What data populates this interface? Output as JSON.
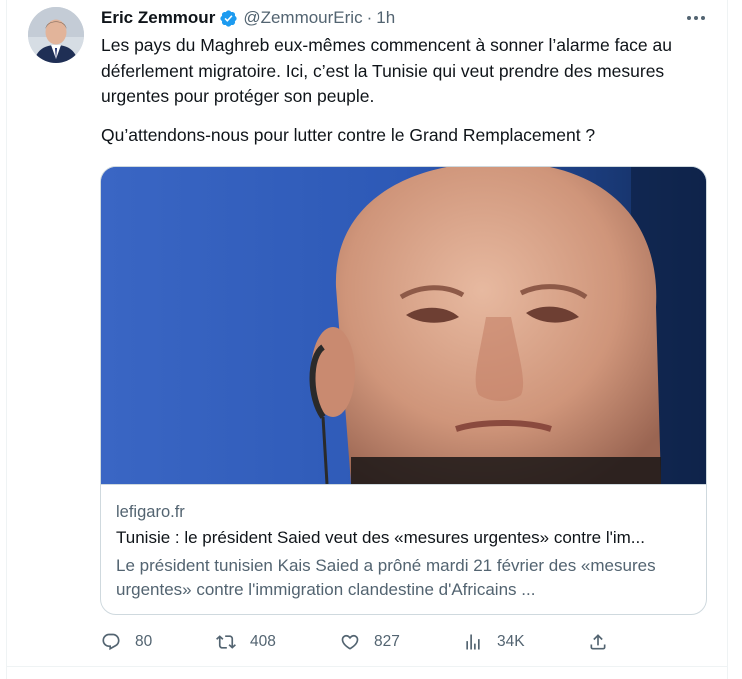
{
  "tweet": {
    "author": {
      "name": "Eric Zemmour",
      "handle": "@ZemmourEric",
      "separator": "·",
      "time": "1h",
      "verified_badge_color": "#1d9bf0"
    },
    "text_paragraphs": [
      "Les pays du Maghreb eux-mêmes commencent à sonner l’alarme face au déferlement migratoire. Ici, c’est la Tunisie qui veut prendre des mesures urgentes pour protéger son peuple.",
      "Qu’attendons-nous pour lutter contre le Grand Remplacement ?"
    ],
    "card": {
      "domain": "lefigaro.fr",
      "title": "Tunisie : le président Saied veut des «mesures urgentes» contre l'im...",
      "description": "Le président tunisien Kais Saied a prôné mardi 21 février des «mesures urgentes» contre l'immigration clandestine d'Africains ..."
    },
    "actions": {
      "reply": {
        "icon": "reply-icon",
        "count": "80"
      },
      "retweet": {
        "icon": "retweet-icon",
        "count": "408"
      },
      "like": {
        "icon": "heart-icon",
        "count": "827"
      },
      "views": {
        "icon": "views-icon",
        "count": "34K"
      },
      "share": {
        "icon": "share-icon"
      }
    }
  },
  "colors": {
    "text_primary": "#0f1419",
    "text_secondary": "#536471",
    "border": "#cfd9de",
    "accent": "#1d9bf0"
  }
}
